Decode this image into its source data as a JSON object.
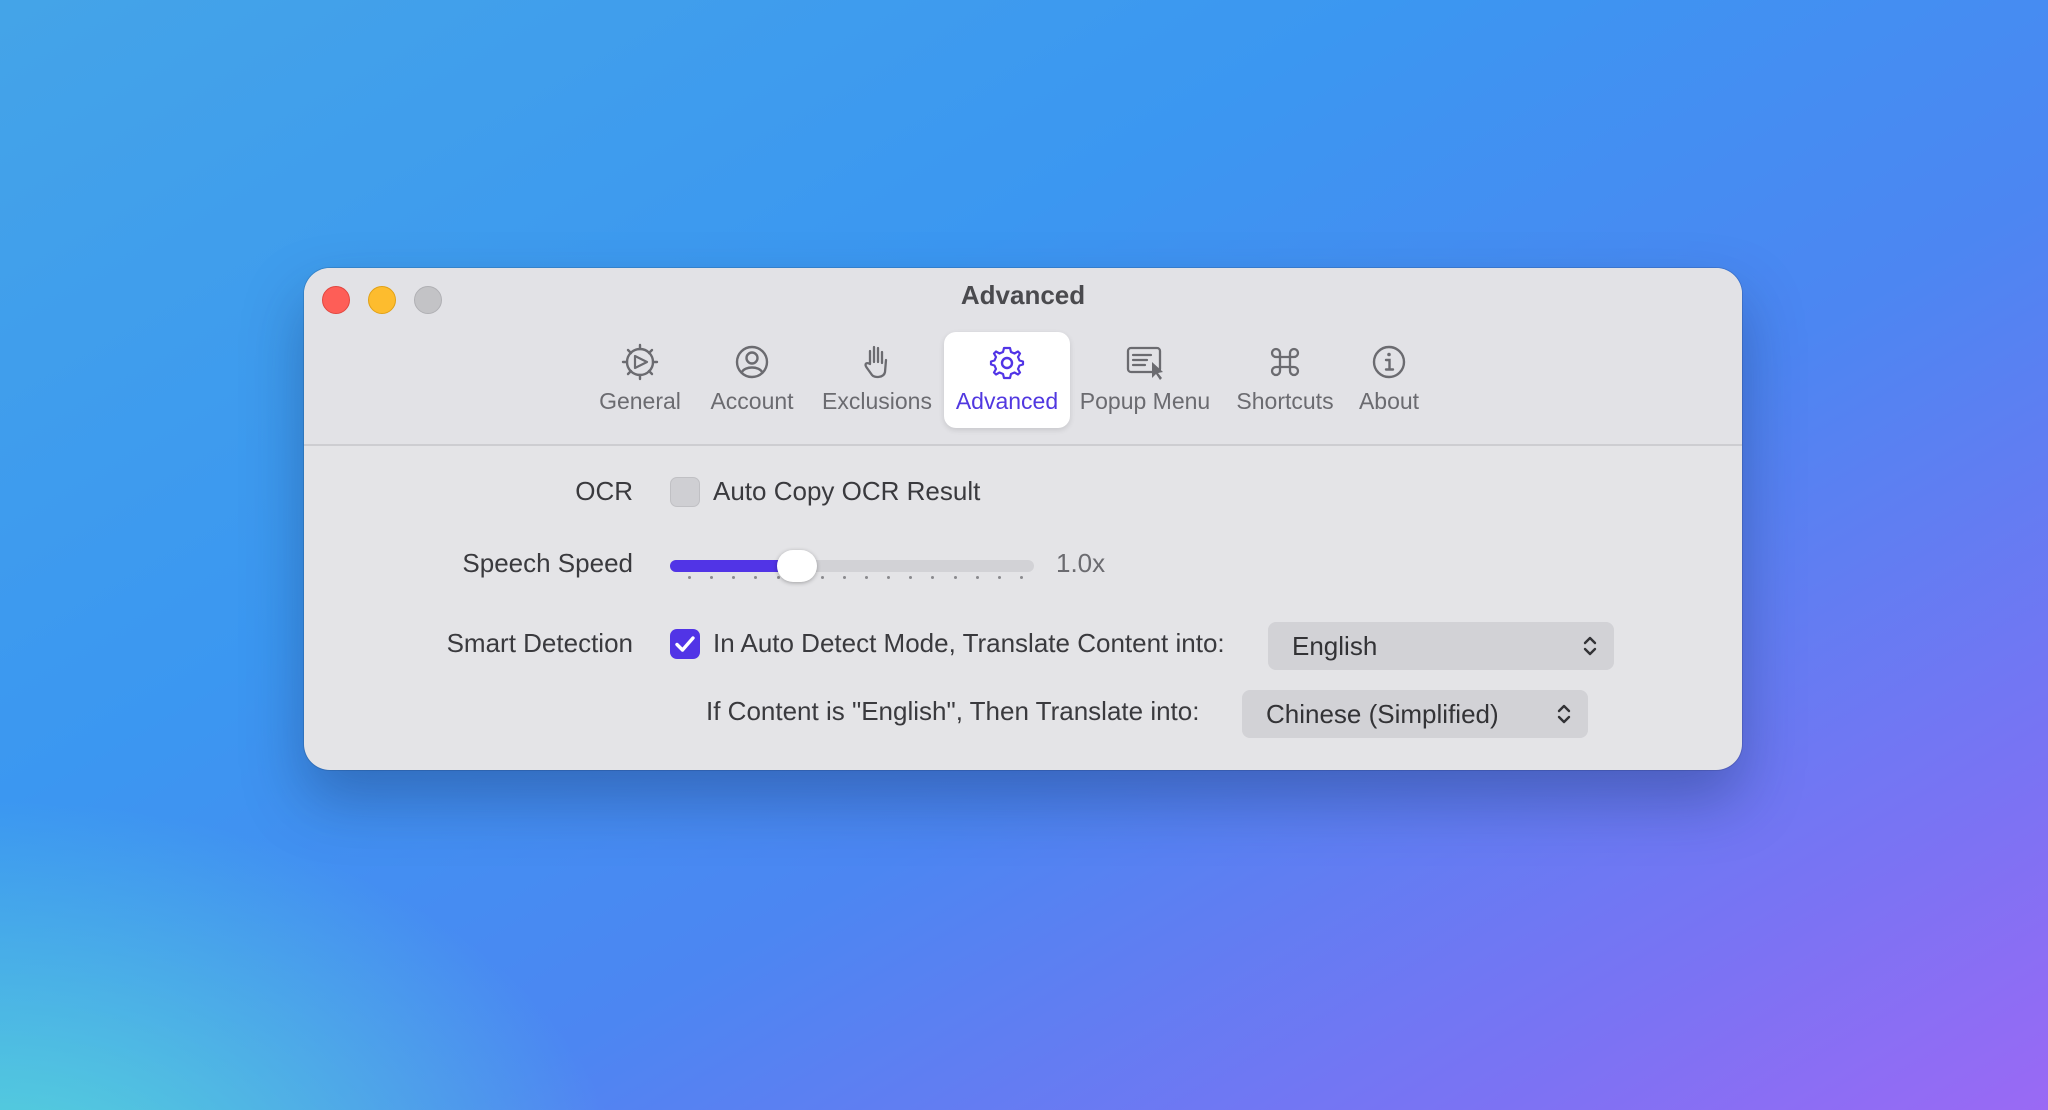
{
  "window": {
    "title": "Advanced"
  },
  "tabs": [
    {
      "label": "General",
      "icon": "gear-dial-icon",
      "active": false
    },
    {
      "label": "Account",
      "icon": "person-circle-icon",
      "active": false
    },
    {
      "label": "Exclusions",
      "icon": "hand-raised-icon",
      "active": false
    },
    {
      "label": "Advanced",
      "icon": "gear-icon",
      "active": true
    },
    {
      "label": "Popup Menu",
      "icon": "popup-menu-icon",
      "active": false
    },
    {
      "label": "Shortcuts",
      "icon": "command-icon",
      "active": false
    },
    {
      "label": "About",
      "icon": "info-circle-icon",
      "active": false
    }
  ],
  "settings": {
    "ocr": {
      "label": "OCR",
      "checkbox_label": "Auto Copy OCR Result",
      "checked": false
    },
    "speech_speed": {
      "label": "Speech Speed",
      "value_text": "1.0x",
      "level": 0.35
    },
    "smart_detection": {
      "label": "Smart Detection",
      "checkbox_label": "In Auto Detect Mode, Translate Content into:",
      "checked": true,
      "target_language": "English",
      "fallback_label": "If Content is \"English\", Then Translate into:",
      "fallback_language": "Chinese (Simplified)"
    }
  },
  "colors": {
    "accent": "#5134e6",
    "close": "#fe5e57",
    "minimize": "#fdbc2e",
    "zoom": "#c3c3c6"
  }
}
